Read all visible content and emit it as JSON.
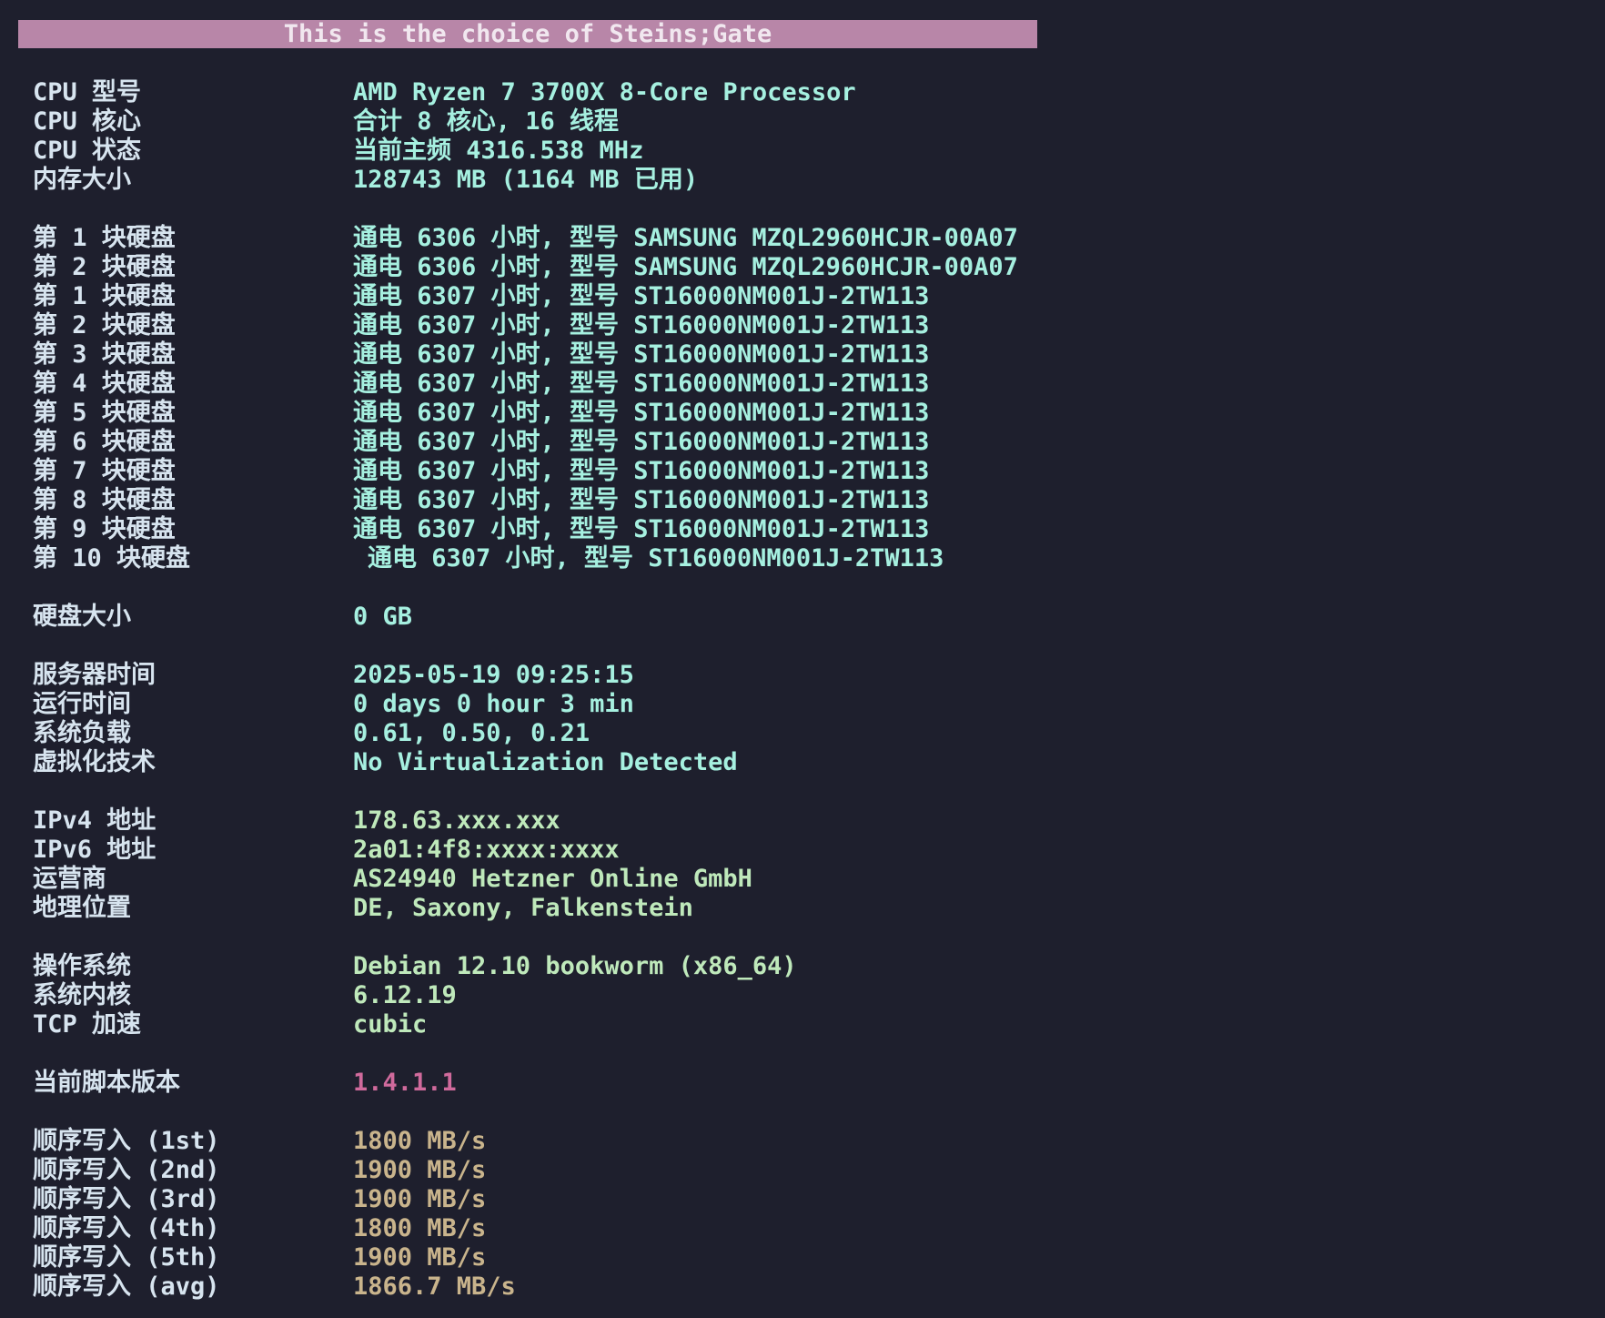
{
  "banner": "This is the choice of Steins;Gate",
  "colors": {
    "background": "#1e1f2d",
    "banner_bg": "#b886a8",
    "label": "#d7e4ef",
    "value_cyan": "#a6f0e0",
    "value_green": "#bfe9bb",
    "value_pink": "#d06a9c",
    "value_tan": "#c9b48c"
  },
  "cpu": [
    {
      "label": "CPU 型号",
      "value": "AMD Ryzen 7 3700X 8-Core Processor"
    },
    {
      "label": "CPU 核心",
      "value": "合计 8 核心, 16 线程"
    },
    {
      "label": "CPU 状态",
      "value": "当前主频 4316.538 MHz"
    },
    {
      "label": "内存大小",
      "value": "128743 MB (1164 MB 已用)"
    }
  ],
  "disks": [
    {
      "label": "第 1 块硬盘",
      "value": "通电 6306 小时, 型号 SAMSUNG MZQL2960HCJR-00A07"
    },
    {
      "label": "第 2 块硬盘",
      "value": "通电 6306 小时, 型号 SAMSUNG MZQL2960HCJR-00A07"
    },
    {
      "label": "第 1 块硬盘",
      "value": "通电 6307 小时, 型号 ST16000NM001J-2TW113"
    },
    {
      "label": "第 2 块硬盘",
      "value": "通电 6307 小时, 型号 ST16000NM001J-2TW113"
    },
    {
      "label": "第 3 块硬盘",
      "value": "通电 6307 小时, 型号 ST16000NM001J-2TW113"
    },
    {
      "label": "第 4 块硬盘",
      "value": "通电 6307 小时, 型号 ST16000NM001J-2TW113"
    },
    {
      "label": "第 5 块硬盘",
      "value": "通电 6307 小时, 型号 ST16000NM001J-2TW113"
    },
    {
      "label": "第 6 块硬盘",
      "value": "通电 6307 小时, 型号 ST16000NM001J-2TW113"
    },
    {
      "label": "第 7 块硬盘",
      "value": "通电 6307 小时, 型号 ST16000NM001J-2TW113"
    },
    {
      "label": "第 8 块硬盘",
      "value": "通电 6307 小时, 型号 ST16000NM001J-2TW113"
    },
    {
      "label": "第 9 块硬盘",
      "value": "通电 6307 小时, 型号 ST16000NM001J-2TW113"
    },
    {
      "label": "第 10 块硬盘",
      "value": "通电 6307 小时, 型号 ST16000NM001J-2TW113"
    }
  ],
  "disk_size": {
    "label": "硬盘大小",
    "value": "0 GB"
  },
  "system": [
    {
      "label": "服务器时间",
      "value": "2025-05-19 09:25:15"
    },
    {
      "label": "运行时间",
      "value": "0 days 0 hour 3 min"
    },
    {
      "label": "系统负载",
      "value": "0.61, 0.50, 0.21"
    },
    {
      "label": "虚拟化技术",
      "value": "No Virtualization Detected"
    }
  ],
  "network": [
    {
      "label": "IPv4 地址",
      "value": "178.63.xxx.xxx"
    },
    {
      "label": "IPv6 地址",
      "value": "2a01:4f8:xxxx:xxxx"
    },
    {
      "label": "运营商",
      "value": "AS24940 Hetzner Online GmbH"
    },
    {
      "label": "地理位置",
      "value": "DE, Saxony, Falkenstein"
    }
  ],
  "os": [
    {
      "label": "操作系统",
      "value": "Debian 12.10 bookworm (x86_64)"
    },
    {
      "label": "系统内核",
      "value": "6.12.19"
    },
    {
      "label": "TCP 加速",
      "value": "cubic"
    }
  ],
  "script_version": {
    "label": "当前脚本版本",
    "value": "1.4.1.1"
  },
  "write_tests": [
    {
      "label": "顺序写入 (1st)",
      "value": "1800 MB/s"
    },
    {
      "label": "顺序写入 (2nd)",
      "value": "1900 MB/s"
    },
    {
      "label": "顺序写入 (3rd)",
      "value": "1900 MB/s"
    },
    {
      "label": "顺序写入 (4th)",
      "value": "1800 MB/s"
    },
    {
      "label": "顺序写入 (5th)",
      "value": "1900 MB/s"
    },
    {
      "label": "顺序写入 (avg)",
      "value": "1866.7 MB/s"
    }
  ]
}
